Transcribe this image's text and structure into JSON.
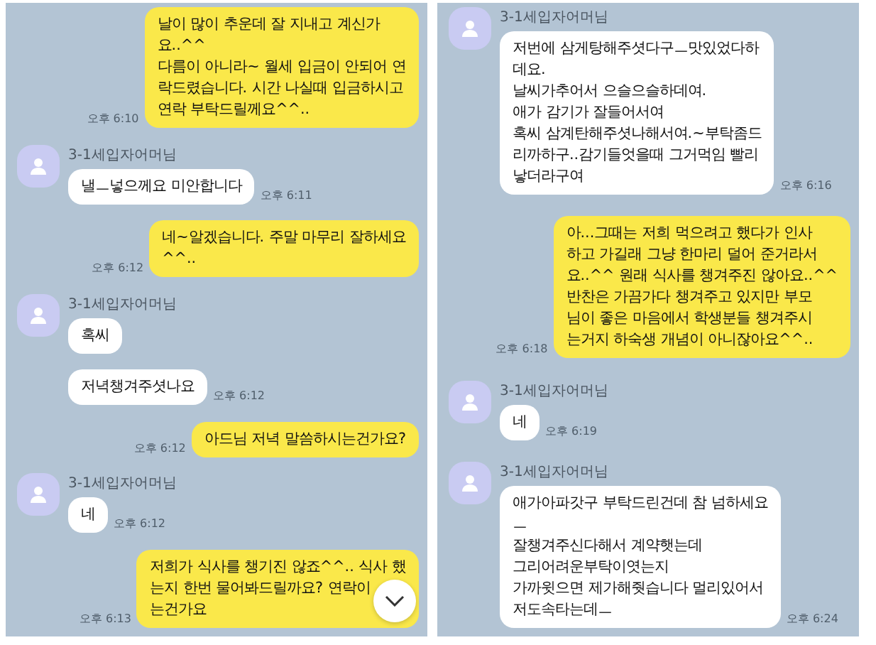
{
  "panels": [
    {
      "scroll_down_button": true,
      "messages": [
        {
          "kind": "sent",
          "text": "날이 많이 추운데 잘 지내고 계신가\n요..^^\n다름이 아니라~ 월세 입금이 안되어 연\n락드렸습니다. 시간 나실때 입금하시고\n연락 부탁드릴께요^^..",
          "time": "오후 6:10"
        },
        {
          "kind": "received",
          "sender": "3-1세입자어머님",
          "text": "낼ㅡ넣으께요 미안합니다",
          "time": "오후 6:11"
        },
        {
          "kind": "sent",
          "text": "네~알겠습니다. 주말 마무리 잘하세요\n^^..",
          "time": "오후 6:12"
        },
        {
          "kind": "received",
          "sender": "3-1세입자어머님",
          "text": "혹씨"
        },
        {
          "kind": "received",
          "text": "저녁챙겨주셧나요",
          "time": "오후 6:12"
        },
        {
          "kind": "sent",
          "text": "아드님 저녁 말씀하시는건가요?",
          "time": "오후 6:12"
        },
        {
          "kind": "received",
          "sender": "3-1세입자어머님",
          "text": "네",
          "time": "오후 6:12"
        },
        {
          "kind": "sent",
          "text": "저희가 식사를 챙기진 않죠^^.. 식사 했\n는지 한번 물어봐드릴까요? 연락이\n는건가요",
          "time": "오후 6:13"
        }
      ]
    },
    {
      "messages": [
        {
          "kind": "received",
          "sender": "3-1세입자어머님",
          "text": "저번에 삼게탕해주셧다구ㅡ맛있었다하\n데요.\n날씨가추어서 으슬으슬하데여.\n애가 감기가 잘들어서여\n혹씨 삼계탄해주셧나해서여.~부탁좀드\n리까하구..감기들엇을때 그거먹임 빨리\n낳더라구여",
          "time": "오후 6:16"
        },
        {
          "kind": "sent",
          "text": "아...그때는 저희 먹으려고 했다가 인사\n하고 가길래 그냥 한마리 덜어 준거라서\n요..^^ 원래 식사를 챙겨주진 않아요..^^\n반찬은 가끔가다 챙겨주고 있지만 부모\n님이 좋은 마음에서 학생분들 챙겨주시\n는거지 하숙생 개념이 아니잖아요^^..",
          "time": "오후 6:18"
        },
        {
          "kind": "received",
          "sender": "3-1세입자어머님",
          "text": "네",
          "time": "오후 6:19"
        },
        {
          "kind": "received",
          "sender": "3-1세입자어머님",
          "text": "애가아파갓구 부탁드린건데 참 넘하세요\nㅡ\n잘챙겨주신다해서 계약햇는데\n그리어려운부탁이엿는지\n가까윗으면 제가해줫습니다 멀리있어서\n저도속타는데ㅡ",
          "time": "오후 6:24"
        }
      ]
    }
  ]
}
